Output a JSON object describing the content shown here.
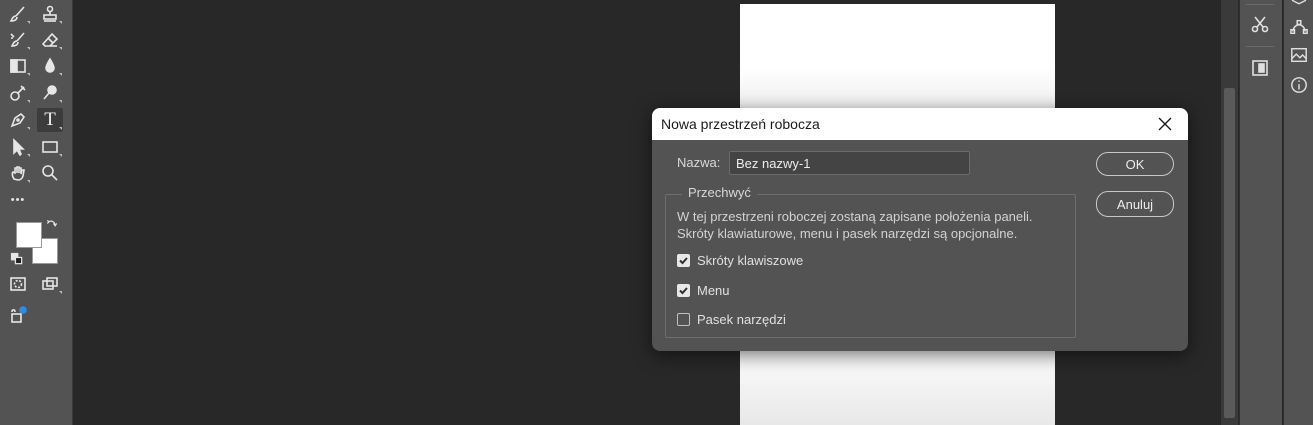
{
  "dialog": {
    "title": "Nowa przestrzeń robocza",
    "name_label": "Nazwa:",
    "name_value": "Bez nazwy-1",
    "ok_label": "OK",
    "cancel_label": "Anuluj",
    "group_title": "Przechwyć",
    "description_line1": "W tej przestrzeni roboczej zostaną zapisane położenia paneli.",
    "description_line2": "Skróty klawiaturowe, menu i pasek narzędzi są opcjonalne.",
    "options": [
      {
        "label": "Skróty klawiszowe",
        "checked": true
      },
      {
        "label": "Menu",
        "checked": true
      },
      {
        "label": "Pasek narzędzi",
        "checked": false
      }
    ]
  },
  "toolbar": {
    "more_tools_label": "•••",
    "text_tool_label": "T"
  },
  "colors": {
    "workspace_bg": "#282828",
    "panel_bg": "#535353",
    "dialog_bg": "#535353",
    "titlebar_bg": "#ffffff",
    "document_bg": "#ffffff"
  }
}
